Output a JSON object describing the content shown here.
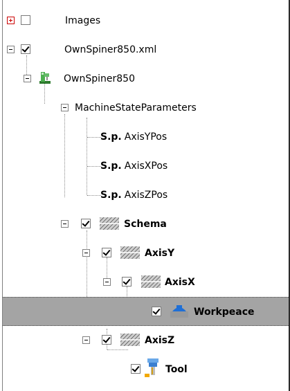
{
  "tree": {
    "images": {
      "label": "Images",
      "checked": false,
      "expanded": false
    },
    "xml": {
      "label": "OwnSpiner850.xml",
      "checked": true,
      "expanded": true,
      "icon": "checkbox-checked"
    },
    "machine": {
      "label": "OwnSpiner850",
      "icon": "machine-icon",
      "expanded": true
    },
    "msp": {
      "label": "MachineStateParameters",
      "expanded": true
    },
    "params": [
      {
        "prefix": "S.p.",
        "label": "AxisYPos"
      },
      {
        "prefix": "S.p.",
        "label": "AxisXPos"
      },
      {
        "prefix": "S.p.",
        "label": "AxisZPos"
      }
    ],
    "schema": {
      "label": "Schema",
      "checked": true,
      "icon": "hatch-icon"
    },
    "axisY": {
      "label": "AxisY",
      "checked": true,
      "icon": "hatch-icon"
    },
    "axisX": {
      "label": "AxisX",
      "checked": true,
      "icon": "hatch-icon"
    },
    "workpeace": {
      "label": "Workpeace",
      "checked": true,
      "icon": "workpiece-icon",
      "selected": true
    },
    "axisZ": {
      "label": "AxisZ",
      "checked": true,
      "icon": "hatch-icon"
    },
    "tool": {
      "label": "Tool",
      "checked": true,
      "icon": "tool-icon"
    }
  },
  "colors": {
    "selection": "#a4a4a4",
    "lines": "#8a8a8a",
    "plus": "#cc0000"
  }
}
